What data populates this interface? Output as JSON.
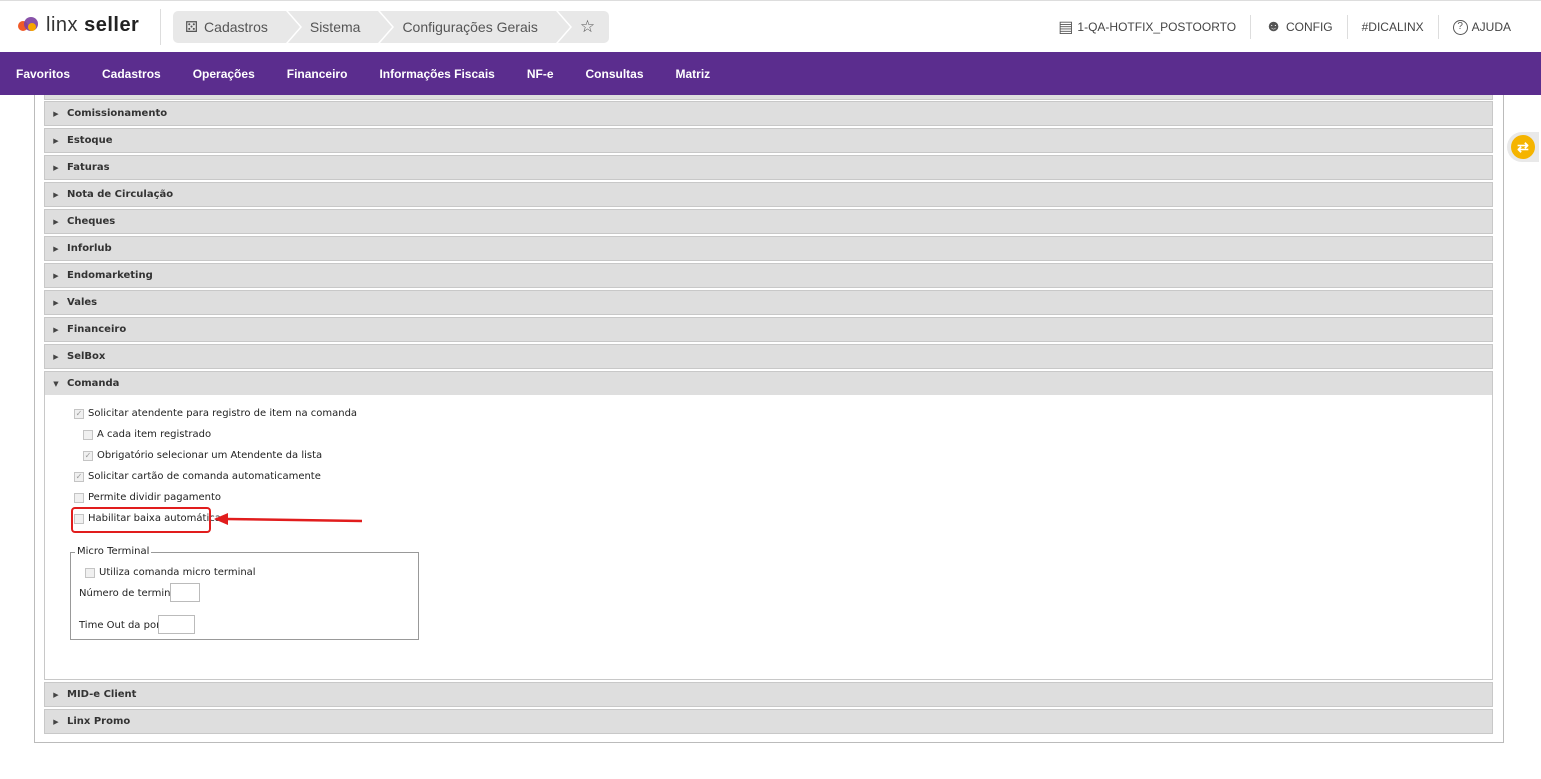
{
  "app": {
    "brand_light": "linx",
    "brand_bold": "seller"
  },
  "breadcrumb": [
    {
      "label": "Cadastros",
      "icon": "users-icon"
    },
    {
      "label": "Sistema"
    },
    {
      "label": "Configurações Gerais"
    }
  ],
  "topright": {
    "store": "1-QA-HOTFIX_POSTOORTO",
    "config": "CONFIG",
    "dica": "#DICALINX",
    "help": "AJUDA"
  },
  "nav": [
    "Favoritos",
    "Cadastros",
    "Operações",
    "Financeiro",
    "Informações Fiscais",
    "NF-e",
    "Consultas",
    "Matriz"
  ],
  "sections_top": [
    "Comissionamento",
    "Estoque",
    "Faturas",
    "Nota de Circulação",
    "Cheques",
    "Inforlub",
    "Endomarketing",
    "Vales",
    "Financeiro",
    "SelBox"
  ],
  "section_open": "Comanda",
  "options": [
    {
      "label": "Solicitar atendente para registro de item na comanda",
      "checked": true
    },
    {
      "label": "A cada item registrado",
      "checked": false
    },
    {
      "label": "Obrigatório selecionar um Atendente da lista",
      "checked": true
    },
    {
      "label": "Solicitar cartão de comanda automaticamente",
      "checked": true
    },
    {
      "label": "Permite dividir pagamento",
      "checked": false
    },
    {
      "label": "Habilitar baixa automática",
      "checked": false
    }
  ],
  "micro_terminal": {
    "legend": "Micro Terminal",
    "use_label": "Utiliza comanda micro terminal",
    "terminals_label": "Número de terminais",
    "timeout_label": "Time Out da porta"
  },
  "sections_bottom": [
    "MID-e Client",
    "Linx Promo"
  ],
  "colors": {
    "nav_bg": "#5b2d8e",
    "highlight": "#e11d1d"
  }
}
